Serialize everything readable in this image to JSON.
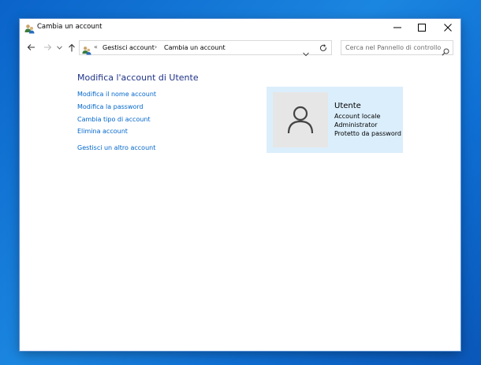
{
  "window": {
    "title": "Cambia un account"
  },
  "address": {
    "overflow": "«",
    "breadcrumbs": [
      "Gestisci account",
      "Cambia un account"
    ],
    "separator": "›"
  },
  "search": {
    "placeholder": "Cerca nel Pannello di controllo"
  },
  "main": {
    "heading": "Modifica l'account di Utente",
    "links": [
      "Modifica il nome account",
      "Modifica la password",
      "Cambia tipo di account",
      "Elimina account",
      "Gestisci un altro account"
    ]
  },
  "user": {
    "name": "Utente",
    "details": [
      "Account locale",
      "Administrator",
      "Protetto da password"
    ]
  },
  "icons": {
    "back": "arrow-left-icon",
    "forward": "arrow-right-icon",
    "recent": "chevron-down-icon",
    "up": "arrow-up-icon",
    "refresh": "refresh-icon",
    "search": "search-icon",
    "avatar": "user-silhouette-icon"
  },
  "colors": {
    "link": "#0066cc",
    "heading": "#1e3287",
    "card": "#dbeefc"
  }
}
